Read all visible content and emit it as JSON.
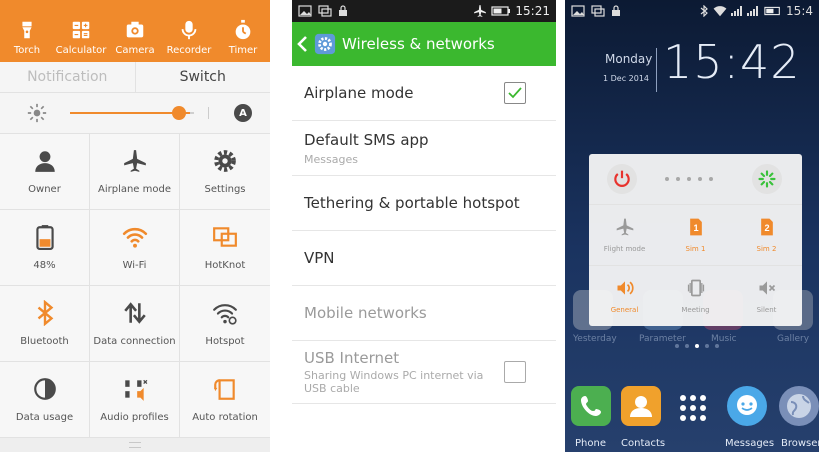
{
  "panel1": {
    "quick_actions": [
      {
        "label": "Torch",
        "icon": "torch-icon"
      },
      {
        "label": "Calculator",
        "icon": "calculator-icon"
      },
      {
        "label": "Camera",
        "icon": "camera-icon"
      },
      {
        "label": "Recorder",
        "icon": "microphone-icon"
      },
      {
        "label": "Timer",
        "icon": "timer-icon"
      }
    ],
    "tabs": {
      "notification": "Notification",
      "switch": "Switch"
    },
    "brightness": {
      "level": 0.9,
      "auto_label": "A"
    },
    "toggles": [
      {
        "label": "Owner",
        "icon": "owner-icon"
      },
      {
        "label": "Airplane mode",
        "icon": "airplane-icon"
      },
      {
        "label": "Settings",
        "icon": "settings-gear-icon"
      },
      {
        "label": "48%",
        "icon": "battery-icon"
      },
      {
        "label": "Wi-Fi",
        "icon": "wifi-icon"
      },
      {
        "label": "HotKnot",
        "icon": "hotknot-icon"
      },
      {
        "label": "Bluetooth",
        "icon": "bluetooth-icon"
      },
      {
        "label": "Data connection",
        "icon": "data-connection-icon"
      },
      {
        "label": "Hotspot",
        "icon": "hotspot-icon"
      },
      {
        "label": "Data usage",
        "icon": "data-usage-icon"
      },
      {
        "label": "Audio profiles",
        "icon": "audio-profiles-icon"
      },
      {
        "label": "Auto rotation",
        "icon": "auto-rotation-icon"
      }
    ],
    "colors": {
      "accent": "#f08a2c",
      "icon_dark": "#4a4a4a"
    }
  },
  "panel2": {
    "status_time": "15:21",
    "title": "Wireless & networks",
    "items": [
      {
        "label": "Airplane mode",
        "sub": "",
        "checkbox": true,
        "checked": true,
        "enabled": true
      },
      {
        "label": "Default SMS app",
        "sub": "Messages",
        "checkbox": false,
        "checked": false,
        "enabled": true
      },
      {
        "label": "Tethering & portable hotspot",
        "sub": "",
        "checkbox": false,
        "checked": false,
        "enabled": true
      },
      {
        "label": "VPN",
        "sub": "",
        "checkbox": false,
        "checked": false,
        "enabled": true
      },
      {
        "label": "Mobile networks",
        "sub": "",
        "checkbox": false,
        "checked": false,
        "enabled": false
      },
      {
        "label": "USB Internet",
        "sub": "Sharing Windows PC internet via USB cable",
        "checkbox": true,
        "checked": false,
        "enabled": false
      }
    ],
    "colors": {
      "actionbar": "#3bb82f",
      "check": "#3bb82f"
    }
  },
  "panel3": {
    "status_time": "15:4",
    "day": "Monday",
    "date": "1 Dec 2014",
    "clock": "15:42",
    "popup_items": [
      {
        "label": "Flight mode",
        "icon": "airplane-icon",
        "active": false
      },
      {
        "label": "Sim 1",
        "icon": "sim1-icon",
        "active": true
      },
      {
        "label": "Sim 2",
        "icon": "sim2-icon",
        "active": true
      },
      {
        "label": "General",
        "icon": "speaker-icon",
        "active": true
      },
      {
        "label": "Meeting",
        "icon": "vibrate-icon",
        "active": false
      },
      {
        "label": "Silent",
        "icon": "mute-icon",
        "active": false
      }
    ],
    "ghost_labels": [
      "Yesterday",
      "Parameter",
      "Music",
      "Gallery"
    ],
    "dock": [
      {
        "label": "Phone",
        "icon": "phone-icon",
        "color": "#4caf50"
      },
      {
        "label": "Contacts",
        "icon": "contacts-icon",
        "color": "#f0a12c"
      },
      {
        "label": "",
        "icon": "apps-grid-icon",
        "color": "#ffffff"
      },
      {
        "label": "Messages",
        "icon": "messages-icon",
        "color": "#4aa8e8"
      },
      {
        "label": "Browser",
        "icon": "browser-icon",
        "color": "#7a8fb8"
      }
    ]
  }
}
